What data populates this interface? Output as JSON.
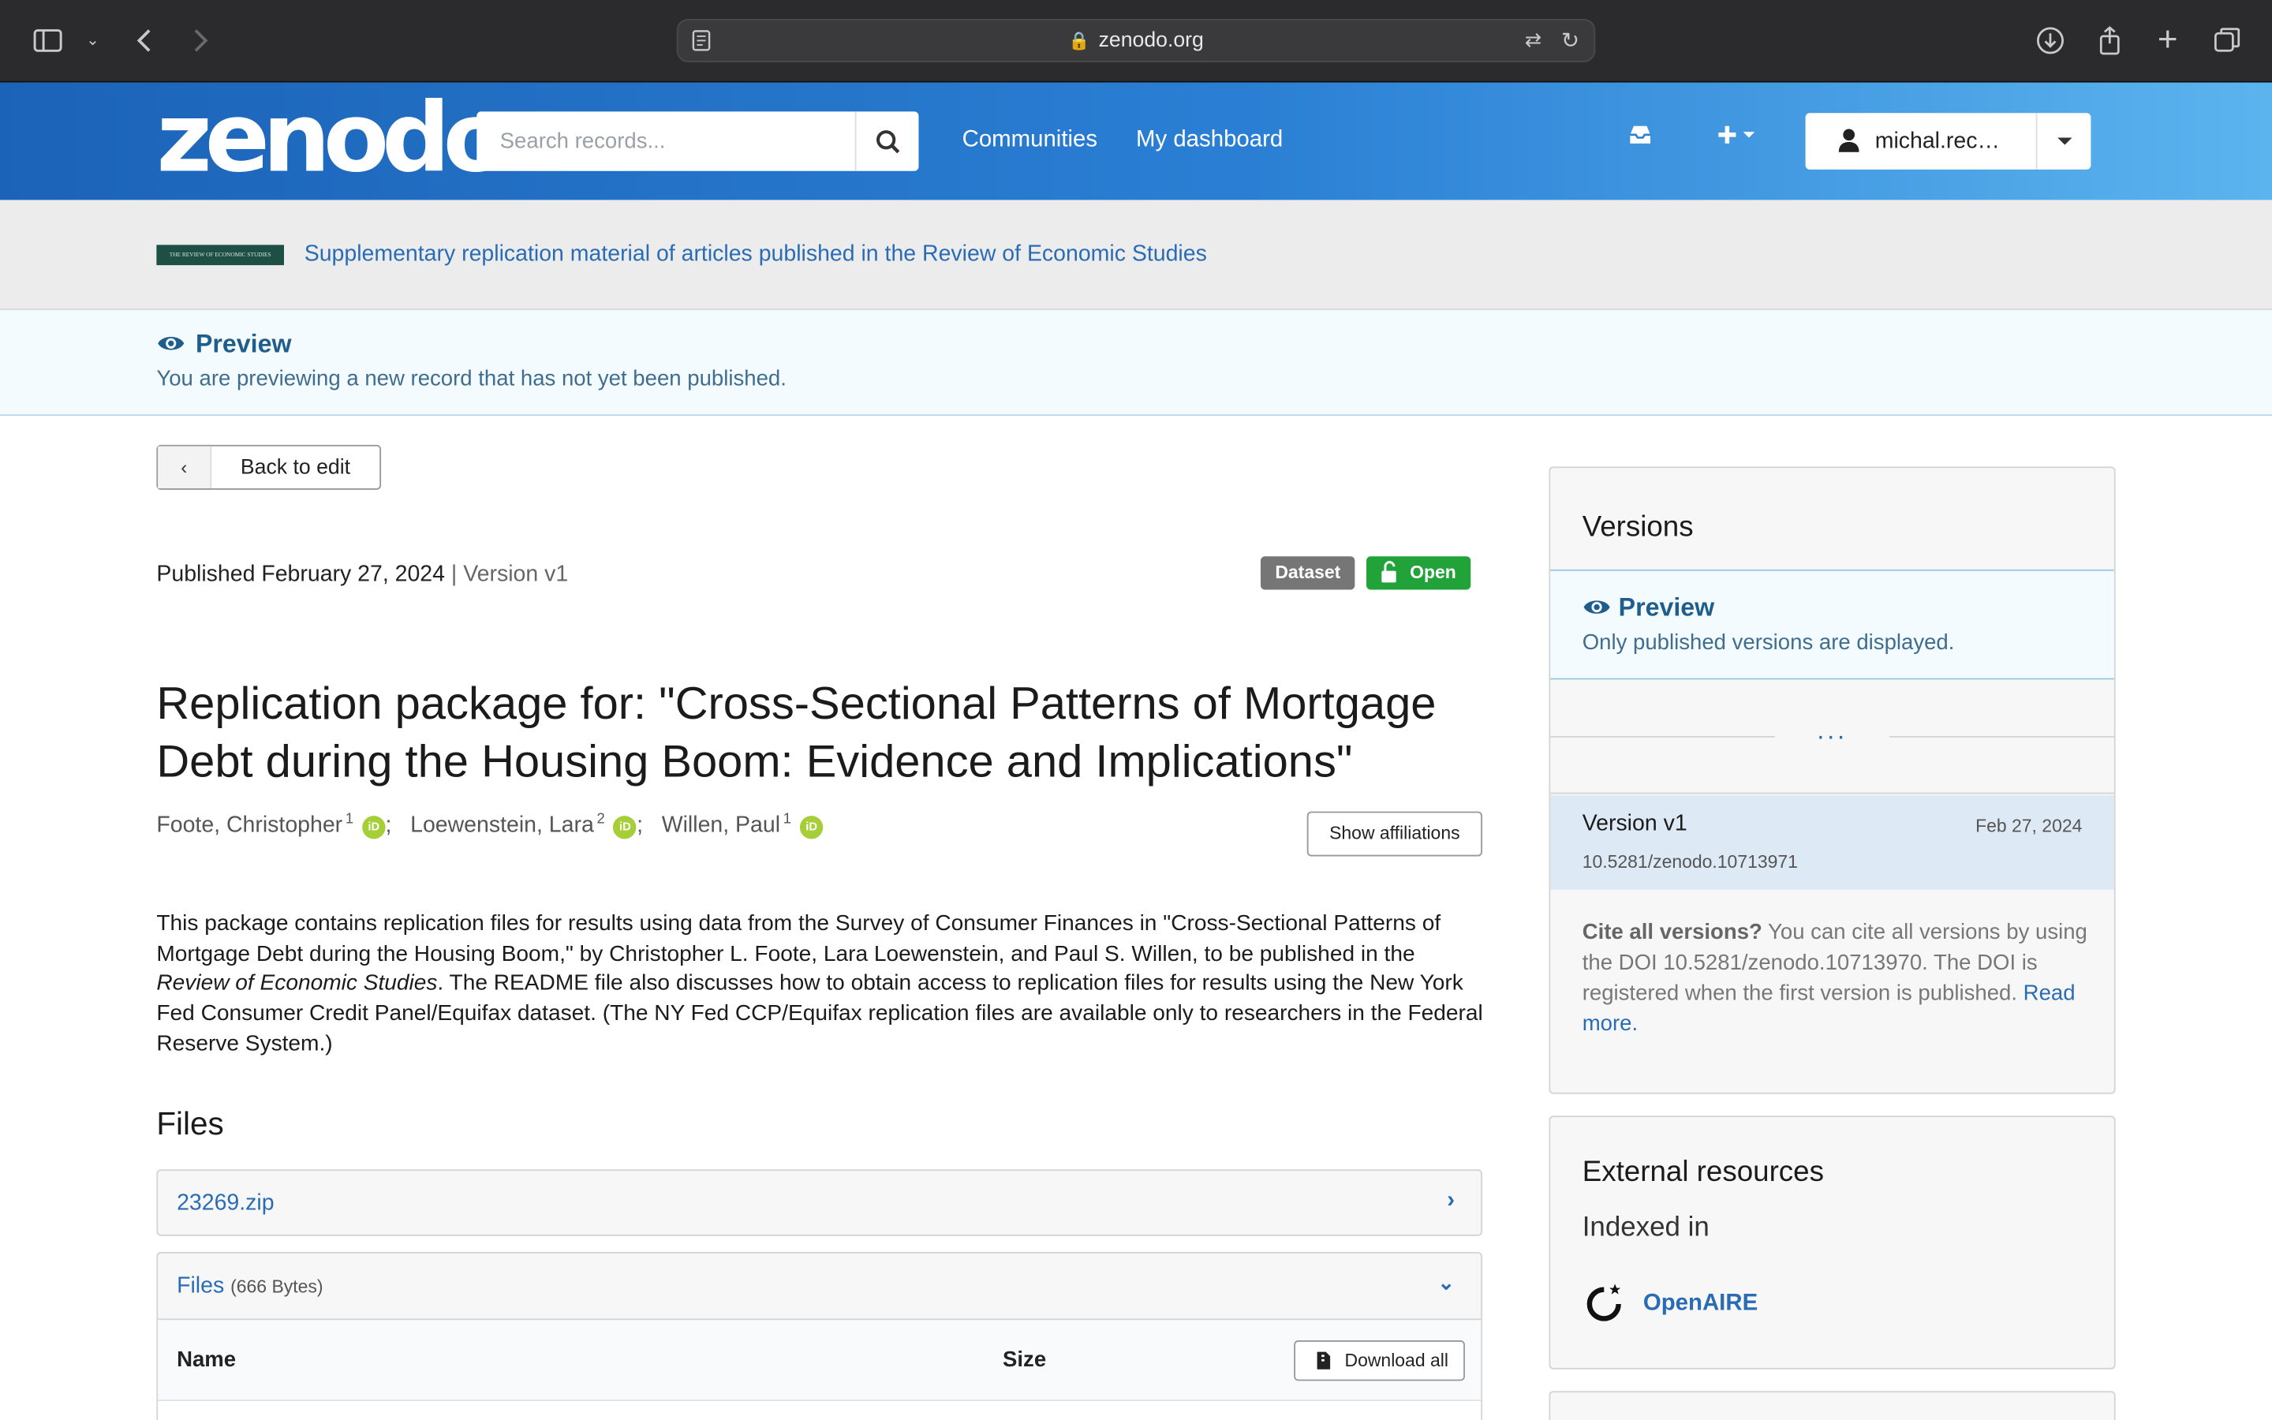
{
  "browser": {
    "url": "zenodo.org"
  },
  "header": {
    "logo": "zenodo",
    "search_placeholder": "Search records...",
    "nav": [
      "Communities",
      "My dashboard"
    ],
    "user": "michal.rec…"
  },
  "community": {
    "logo_text": "THE REVIEW OF ECONOMIC STUDIES",
    "title": "Supplementary replication material of articles published in the Review of Economic Studies"
  },
  "preview": {
    "title": "Preview",
    "text": "You are previewing a new record that has not yet been published."
  },
  "main": {
    "back_label": "Back to edit",
    "published": "Published February 27, 2024",
    "separator": "|",
    "version": "Version v1",
    "badges": {
      "type": "Dataset",
      "access": "Open"
    },
    "title": "Replication package for: \"Cross-Sectional Patterns of Mortgage Debt during the Housing Boom: Evidence and Implications\"",
    "authors": [
      {
        "name": "Foote, Christopher",
        "aff": "1"
      },
      {
        "name": "Loewenstein, Lara",
        "aff": "2"
      },
      {
        "name": "Willen, Paul",
        "aff": "1"
      }
    ],
    "author_sep": ";",
    "show_affiliations": "Show affiliations",
    "description": {
      "p1": "This package contains replication files for results using data from the Survey of Consumer Finances in \"Cross-Sectional Patterns of Mortgage Debt during the Housing Boom,\" by Christopher L. Foote, Lara Loewenstein, and Paul S. Willen, to be published in the",
      "journal": "Review of Economic Studies",
      "p2": ". The README file also discusses how to obtain access to replication files for results using the New York Fed Consumer Credit Panel/Equifax dataset. (The NY Fed CCP/Equifax replication files are available only to researchers in the Federal Reserve System.)"
    },
    "files_heading": "Files",
    "file_name": "23269.zip",
    "files_label": "Files",
    "files_size": "(666 Bytes)",
    "table_headers": {
      "name": "Name",
      "size": "Size"
    },
    "download_all": "Download all"
  },
  "sidebar": {
    "versions_title": "Versions",
    "preview_title": "Preview",
    "preview_text": "Only published versions are displayed.",
    "ellipsis": "...",
    "version_name": "Version v1",
    "version_date": "Feb 27, 2024",
    "version_doi": "10.5281/zenodo.10713971",
    "cite_bold": "Cite all versions?",
    "cite_text": " You can cite all versions by using the DOI 10.5281/zenodo.10713970. The DOI is registered when the first version is published. ",
    "read_more": "Read more.",
    "external_title": "External resources",
    "indexed_in": "Indexed in",
    "openaire": "OpenAIRE"
  }
}
